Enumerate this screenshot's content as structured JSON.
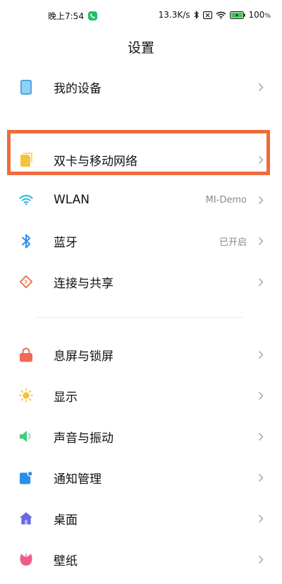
{
  "status_bar": {
    "time": "晚上7:54",
    "speed": "13.3K/s",
    "battery": "100",
    "battery_unit": "%"
  },
  "header": {
    "title": "设置"
  },
  "items": [
    {
      "label": "我的设备",
      "value": "",
      "icon": "device-icon",
      "color": "#4aa7e8"
    },
    {
      "label": "双卡与移动网络",
      "value": "",
      "icon": "sim-card-icon",
      "color": "#f5c33b"
    },
    {
      "label": "WLAN",
      "value": "MI-Demo",
      "icon": "wifi-icon",
      "color": "#2fb6e6"
    },
    {
      "label": "蓝牙",
      "value": "已开启",
      "icon": "bluetooth-icon",
      "color": "#2d8ee6"
    },
    {
      "label": "连接与共享",
      "value": "",
      "icon": "connection-share-icon",
      "color": "#e8714a"
    },
    {
      "label": "息屏与锁屏",
      "value": "",
      "icon": "lock-icon",
      "color": "#ef6a5a"
    },
    {
      "label": "显示",
      "value": "",
      "icon": "sun-icon",
      "color": "#f6c23c"
    },
    {
      "label": "声音与振动",
      "value": "",
      "icon": "speaker-icon",
      "color": "#3fcf79"
    },
    {
      "label": "通知管理",
      "value": "",
      "icon": "notification-icon",
      "color": "#2b8ee8"
    },
    {
      "label": "桌面",
      "value": "",
      "icon": "home-icon",
      "color": "#6a67e8"
    },
    {
      "label": "壁纸",
      "value": "",
      "icon": "wallpaper-icon",
      "color": "#ef5d86"
    }
  ],
  "highlight_color": "#ef6b3c"
}
